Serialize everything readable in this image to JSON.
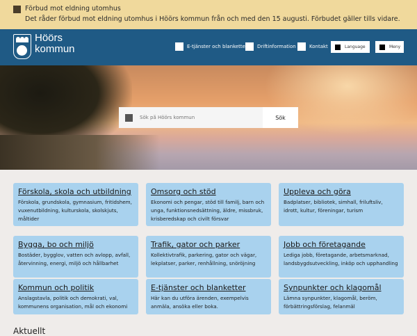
{
  "alert": {
    "title": "Förbud mot eldning utomhus",
    "text": "Det råder förbud mot eldning utomhus i Höörs kommun från och med den 15 augusti. Förbudet gäller tills vidare."
  },
  "header": {
    "logo_line1": "Höörs",
    "logo_line2": "kommun",
    "nav": [
      "E-tjänster och blanketter",
      "Driftinformation",
      "Kontakt"
    ],
    "language": "Language",
    "menu": "Meny"
  },
  "search": {
    "placeholder": "Sök på Höörs kommun",
    "button": "Sök"
  },
  "cards": [
    {
      "title": "Förskola, skola och utbildning",
      "text": "Förskola, grundskola, gymnasium, fritidshem, vuxenutbildning, kulturskola, skolskjuts, måltider"
    },
    {
      "title": "Omsorg och stöd",
      "text": "Ekonomi och pengar, stöd till familj, barn och unga, funktionsnedsättning, äldre, missbruk, krisberedskap och civilt försvar"
    },
    {
      "title": "Uppleva och göra",
      "text": "Badplatser, bibliotek, simhall, friluftsliv, idrott, kultur, föreningar, turism"
    },
    {
      "title": "Bygga, bo och miljö",
      "text": "Bostäder, bygglov, vatten och avlopp, avfall, återvinning, energi, miljö och hållbarhet"
    },
    {
      "title": "Trafik, gator och parker",
      "text": "Kollektivtrafik, parkering, gator och vägar, lekplatser, parker, renhållning, snöröjning"
    },
    {
      "title": "Jobb och företagande",
      "text": "Lediga jobb, företagande, arbetsmarknad, landsbygdsutveckling, inköp och upphandling"
    },
    {
      "title": "Kommun och politik",
      "text": "Anslagstavla, politik och demokrati, val, kommunens organisation, mål och ekonomi"
    },
    {
      "title": "E-tjänster och blanketter",
      "text": "Här kan du utföra ärenden, exempelvis anmäla, ansöka eller boka."
    },
    {
      "title": "Synpunkter och klagomål",
      "text": "Lämna synpunkter, klagomål, beröm, förbättringsförslag, felanmäl"
    }
  ],
  "section_title": "Aktuellt"
}
